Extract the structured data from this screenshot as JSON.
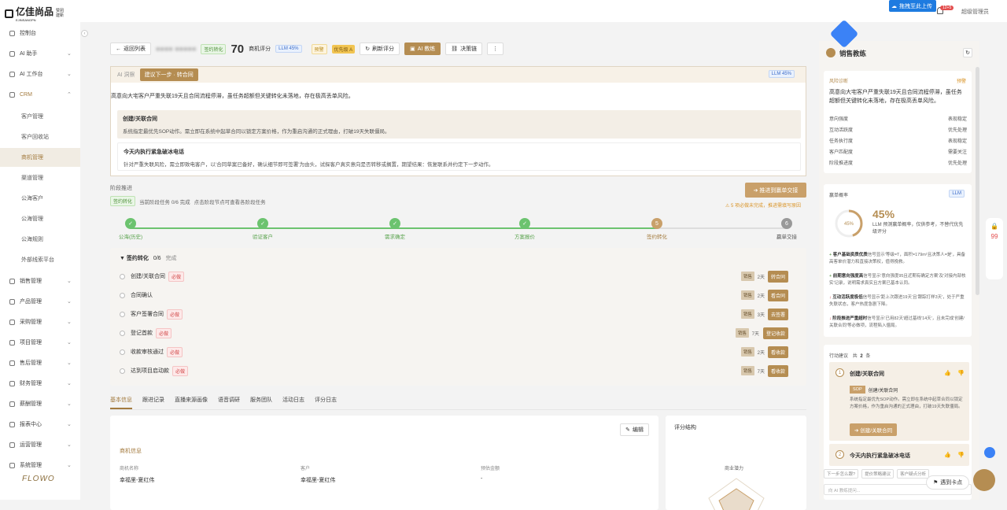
{
  "brand": {
    "name": "亿佳尚品",
    "sub1": "赞团",
    "sub2": "建新",
    "latin": "EJINSANGPN"
  },
  "topbar": {
    "upload": "拖拽至此上传",
    "badge": "12+5",
    "user": "超级管理员"
  },
  "sidebar": {
    "items": [
      {
        "label": "控制台",
        "icon": "dashboard-icon"
      },
      {
        "label": "AI 助手",
        "icon": "ai-icon"
      },
      {
        "label": "AI 工作台",
        "icon": "workbench-icon"
      },
      {
        "label": "CRM",
        "icon": "crm-icon"
      },
      {
        "label": "销售管理",
        "icon": "sales-icon"
      },
      {
        "label": "产品管理",
        "icon": "product-icon"
      },
      {
        "label": "采购管理",
        "icon": "purchase-icon"
      },
      {
        "label": "项目管理",
        "icon": "project-icon"
      },
      {
        "label": "售后管理",
        "icon": "aftersale-icon"
      },
      {
        "label": "财务管理",
        "icon": "finance-icon"
      },
      {
        "label": "薪酬管理",
        "icon": "salary-icon"
      },
      {
        "label": "报表中心",
        "icon": "report-icon"
      },
      {
        "label": "运营管理",
        "icon": "ops-icon"
      },
      {
        "label": "系统管理",
        "icon": "system-icon"
      }
    ],
    "crm_sub": [
      "客户管理",
      "客户回收站",
      "商机管理",
      "渠道管理",
      "公海客户",
      "公海管理",
      "公海规则",
      "外部线索平台"
    ],
    "footer": "FLOWO"
  },
  "header": {
    "back": "返回列表",
    "masked": "■■■■ ■■■■■",
    "stage_tag": "签约转化",
    "score": "70",
    "score_label": "商机评分",
    "llm": "LLM 45%",
    "warn": "预警",
    "priority": "优先级 A",
    "refresh": "刷新评分",
    "coach": "AI 教练",
    "decision": "决策链",
    "more": "⋮"
  },
  "ai_card": {
    "tab_plain": "AI 洞察",
    "tab_active": "建议下一步 · 转合同",
    "llm": "LLM 45%",
    "summary": "高意向大宅客户严重失联19天且合同流程停滞，虽任务超额但关键转化未落地，存在极高丢单风险。",
    "items": [
      {
        "title": "创建/关联合同",
        "desc": "系统指定最优先SOP动作。需立即在系统中起草合同以锁定方案价格，作为重启沟通的正式理由，打破19天失联僵局。"
      },
      {
        "title": "今天内执行紧急破冰电话",
        "desc": "针对严重失联风险，需立即致电客户，以'合同草案已备好，确认细节即可签署'为由头，试探客户真实意向是否转移或搁置，期望结果：恢复联系并约定下一步动作。"
      }
    ]
  },
  "stage": {
    "title": "阶段推进",
    "tag": "签约转化",
    "progress": "当前阶段任务 0/6 完成",
    "hint": "点击阶段节点可查看各阶段任务",
    "advance": "推进到赢单交接",
    "warn": "5 项必做未完成，推进需填写原因",
    "steps": [
      {
        "label": "公海(历史)",
        "mark": "✓",
        "state": "done"
      },
      {
        "label": "验证客户",
        "mark": "✓",
        "state": "done"
      },
      {
        "label": "需求确定",
        "mark": "✓",
        "state": "done"
      },
      {
        "label": "方案报价",
        "mark": "✓",
        "state": "done"
      },
      {
        "label": "签约转化",
        "mark": "5",
        "state": "current"
      },
      {
        "label": "赢单交接",
        "mark": "6",
        "state": "todo"
      }
    ]
  },
  "tasks": {
    "head": "▼ 签约转化",
    "count": "0/6",
    "done_word": "完成",
    "rows": [
      {
        "name": "创建/关联合同",
        "required": "必做",
        "role": "销售",
        "days": "2天",
        "action": "转合同"
      },
      {
        "name": "合同确认",
        "required": "",
        "role": "销售",
        "days": "2天",
        "action": "看合同"
      },
      {
        "name": "客户签署合同",
        "required": "必做",
        "role": "销售",
        "days": "3天",
        "action": "去签署"
      },
      {
        "name": "登记首款",
        "required": "必做",
        "role": "销售",
        "days": "7天",
        "action": "登记收款"
      },
      {
        "name": "收款审核通过",
        "required": "必做",
        "role": "销售",
        "days": "2天",
        "action": "看收款"
      },
      {
        "name": "达到项目启动款",
        "required": "必做",
        "role": "销售",
        "days": "7天",
        "action": "看收款"
      }
    ]
  },
  "tabs": [
    "基本信息",
    "跟进记录",
    "直播来源画像",
    "语音调研",
    "服务团队",
    "活动日志",
    "评分日志"
  ],
  "info": {
    "edit": "编辑",
    "section": "商机信息",
    "fields": [
      {
        "label": "商机名称",
        "value": "幸福里-夏红伟"
      },
      {
        "label": "客户",
        "value": "幸福里-夏红伟"
      },
      {
        "label": "预估金额",
        "value": "-"
      }
    ]
  },
  "score_panel": {
    "title": "评分结构",
    "axis": "商业潜力"
  },
  "coach": {
    "title": "销售教练",
    "refresh": "↻",
    "risk": {
      "head": "风险诊断",
      "warn": "预警",
      "text": "高意向大宅客户严重失联19天且合同流程停滞，虽任务超额但关键转化未落地，存在极高丢单风险。",
      "rows": [
        {
          "k": "意向强度",
          "v": "表现稳定"
        },
        {
          "k": "互动活跃度",
          "v": "优先处理"
        },
        {
          "k": "任务执行度",
          "v": "表现稳定"
        },
        {
          "k": "客户匹配度",
          "v": "需要关注"
        },
        {
          "k": "阶段推进度",
          "v": "优先处理"
        }
      ]
    },
    "prob": {
      "head": "赢单概率",
      "llm": "LLM",
      "value": "45%",
      "gauge": "45%",
      "note": "LLM 预测赢单概率，仅供参考，不替代优先级评分",
      "facts": [
        {
          "t": "客户基础资质优质",
          "d": "信号显示'等级=T，面积=179m²且决策人=是'，具备高客单价潜力和直接决策权，值得挽救。",
          "c": "#4d8f38",
          "s": "+"
        },
        {
          "t": "前期意向强度高",
          "d": "信号显示'意向强度95且近期有确定方案'及'对接内部核实'记录，说明需求真实且方案已基本认同。",
          "c": "#4d8f38",
          "s": "+"
        },
        {
          "t": "互动活跃度极低",
          "d": "信号显示'距上次跟进19天'且'跟踪打样3天'，处于严重失联状态，客户热度急剧下降。",
          "c": "#d24848",
          "s": "↓"
        },
        {
          "t": "阶段推进严重超时",
          "d": "信号显示'已用82天'超过基线'14天'，且未完成'创建/关联合同'等必做项，流程陷入僵局。",
          "c": "#d24848",
          "s": "↓"
        }
      ]
    },
    "advice": {
      "head": "行动建议",
      "count_pre": "共",
      "count": "2",
      "count_post": "条",
      "items": [
        {
          "num": "1",
          "title": "创建/关联合同",
          "sop": "SOP",
          "sop_label": "创建/关联合同",
          "desc": "系统指定最优先SOP动作。需立即在系统中起草合同以锁定方案价格，作为重启沟通的正式理由，打破19天失联僵局。",
          "btn": "创建/关联合同"
        },
        {
          "num": "2",
          "title": "今天内执行紧急破冰电话"
        }
      ],
      "quick": [
        "下一步怎么跟?",
        "提价策略建议",
        "客户疑点分析"
      ],
      "placeholder": "向 AI 教练提问..."
    }
  },
  "widgets": {
    "encounter": "遇到卡点",
    "side_count": "99"
  },
  "colors": {
    "accent": "#b58d52",
    "done": "#6cc36f",
    "todo": "#bbbbbb"
  }
}
